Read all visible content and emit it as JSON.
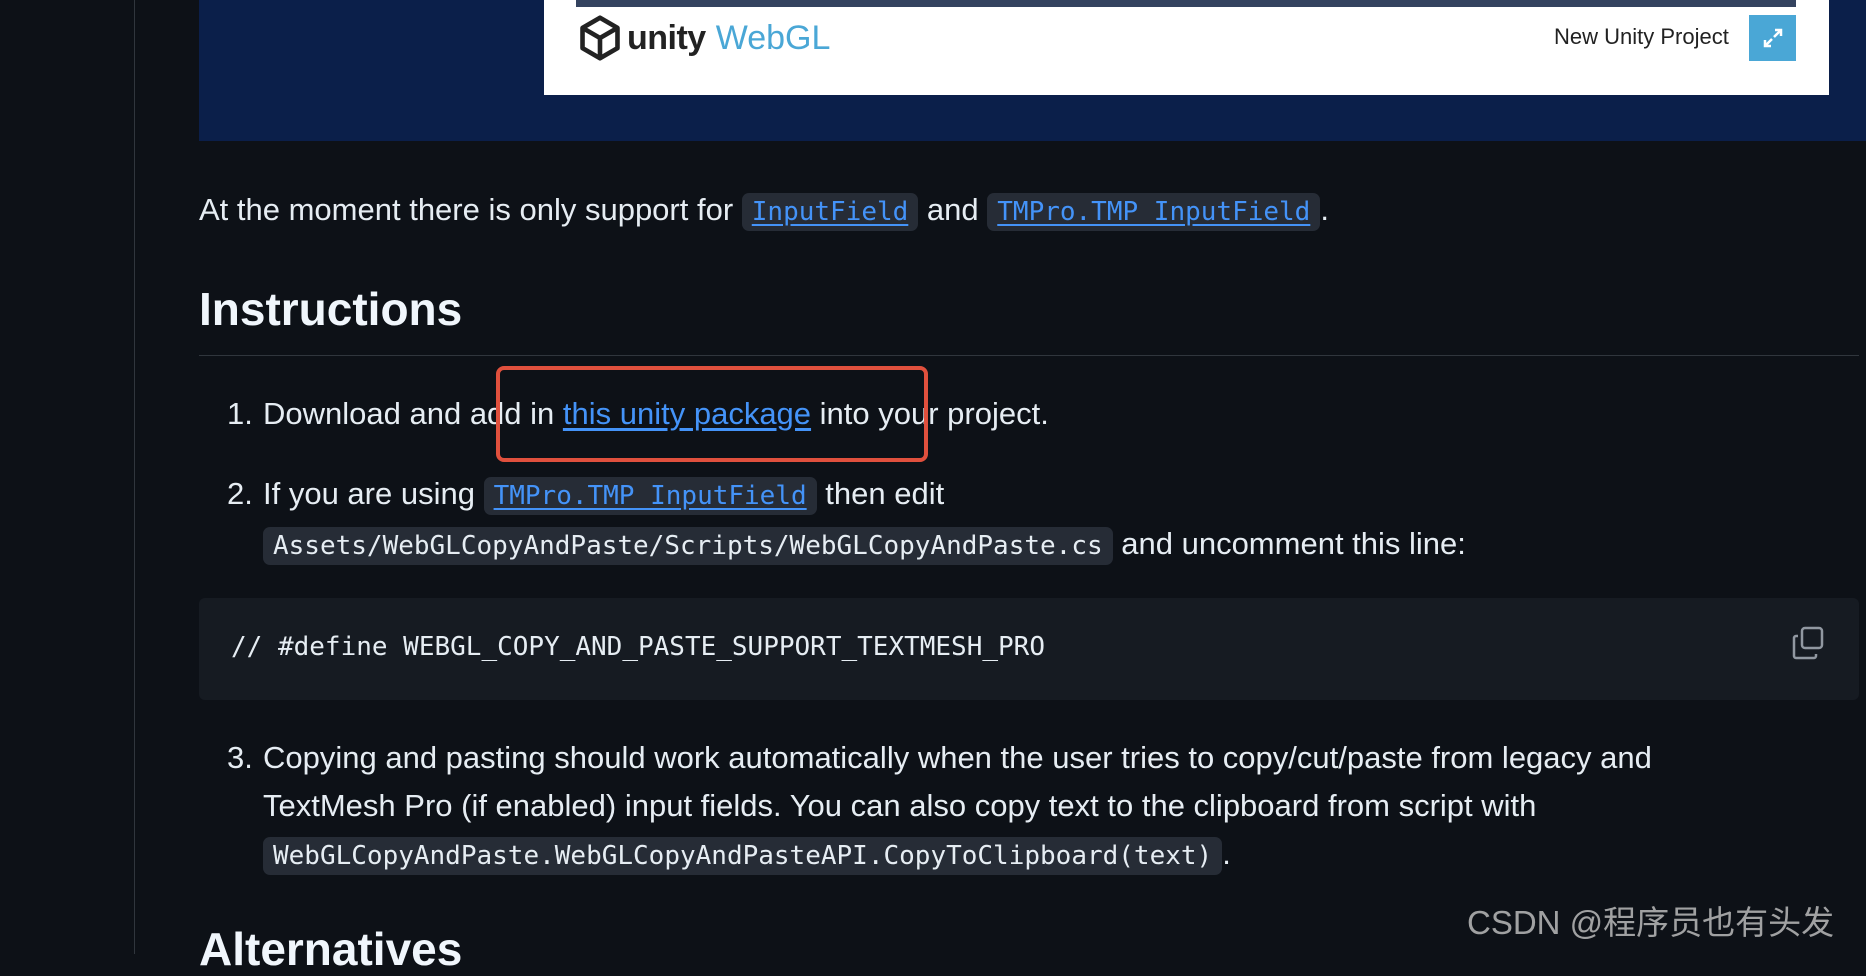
{
  "preview": {
    "logo_unity": "unity",
    "logo_webgl": "WebGL",
    "project_title": "New Unity Project",
    "fullscreen_icon": "fullscreen-icon",
    "colors": {
      "background": "#0b1f4a",
      "accent": "#4aa7d6"
    }
  },
  "support_note": {
    "prefix": "At the moment there is only support for ",
    "code1": "InputField",
    "mid": " and ",
    "code2": "TMPro.TMP_InputField",
    "suffix": "."
  },
  "instructions": {
    "heading": "Instructions",
    "items": [
      {
        "num": "1.",
        "before": "Download and add in ",
        "link": "this unity package",
        "after": " into your project."
      },
      {
        "num": "2.",
        "before": "If you are using ",
        "code": "TMPro.TMP_InputField",
        "mid": " then edit",
        "path": "Assets/WebGLCopyAndPaste/Scripts/WebGLCopyAndPaste.cs",
        "after": " and uncomment this line:"
      },
      {
        "num": "3.",
        "line1": "Copying and pasting should work automatically when the user tries to copy/cut/paste from legacy and",
        "line2": "TextMesh Pro (if enabled) input fields. You can also copy text to the clipboard from script with",
        "code": "WebGLCopyAndPaste.WebGLCopyAndPasteAPI.CopyToClipboard(text)",
        "after": "."
      }
    ],
    "code_block": "// #define WEBGL_COPY_AND_PASTE_SUPPORT_TEXTMESH_PRO"
  },
  "next_heading": "Alternatives",
  "watermark": "CSDN @程序员也有头发",
  "colors": {
    "link": "#4493f8",
    "highlight": "#e0503d"
  }
}
